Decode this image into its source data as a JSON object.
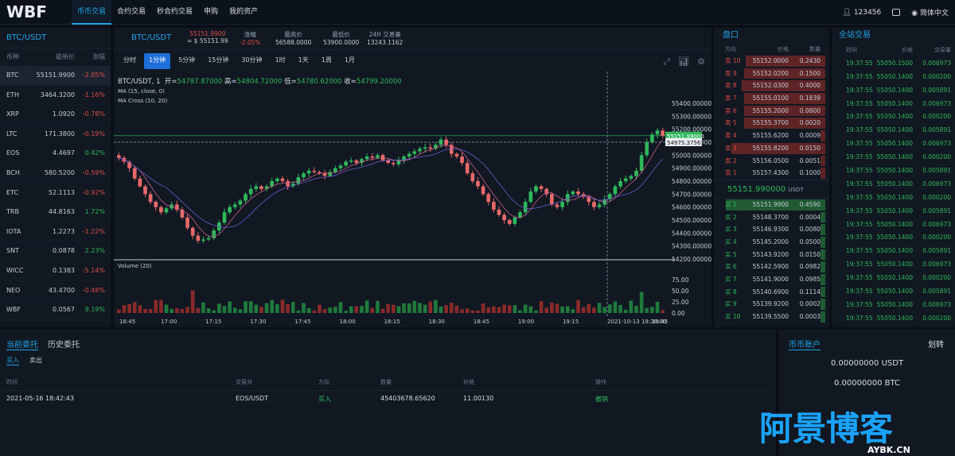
{
  "logo": "WBF",
  "nav": [
    "币币交易",
    "合约交易",
    "秒合约交易",
    "申购",
    "我的资产"
  ],
  "user": {
    "id": "123456",
    "lang": "简体中文"
  },
  "market": {
    "title": "BTC/USDT",
    "cols": [
      "币种",
      "最新价",
      "涨幅"
    ],
    "rows": [
      {
        "sym": "BTC",
        "price": "55151.9900",
        "chg": "-2.05%",
        "dir": "down"
      },
      {
        "sym": "ETH",
        "price": "3464.3200",
        "chg": "-1.16%",
        "dir": "down"
      },
      {
        "sym": "XRP",
        "price": "1.0920",
        "chg": "-0.78%",
        "dir": "down"
      },
      {
        "sym": "LTC",
        "price": "171.3800",
        "chg": "-0.19%",
        "dir": "down"
      },
      {
        "sym": "EOS",
        "price": "4.4697",
        "chg": "0.42%",
        "dir": "up"
      },
      {
        "sym": "BCH",
        "price": "580.5200",
        "chg": "-0.59%",
        "dir": "down"
      },
      {
        "sym": "ETC",
        "price": "52.1113",
        "chg": "-0.92%",
        "dir": "down"
      },
      {
        "sym": "TRB",
        "price": "44.8163",
        "chg": "1.72%",
        "dir": "up"
      },
      {
        "sym": "IOTA",
        "price": "1.2273",
        "chg": "-1.22%",
        "dir": "down"
      },
      {
        "sym": "SNT",
        "price": "0.0878",
        "chg": "2.23%",
        "dir": "up"
      },
      {
        "sym": "WICC",
        "price": "0.1383",
        "chg": "-5.14%",
        "dir": "down"
      },
      {
        "sym": "NEO",
        "price": "43.4700",
        "chg": "-0.48%",
        "dir": "down"
      },
      {
        "sym": "WBF",
        "price": "0.0567",
        "chg": "9.19%",
        "dir": "up"
      }
    ]
  },
  "ticker": {
    "pair": "BTC/USDT",
    "last": "55151.9900",
    "last_cny": "≈ $ 55151.99",
    "chg_label": "涨幅",
    "chg": "-2.05%",
    "high_label": "最高价",
    "high": "56588.0000",
    "low_label": "最低价",
    "low": "53900.0000",
    "vol_label": "24H 交易量",
    "vol": "13243.1162"
  },
  "intervals": [
    "分时",
    "1分钟",
    "5分钟",
    "15分钟",
    "30分钟",
    "1时",
    "1天",
    "1周",
    "1月"
  ],
  "chart_data": {
    "type": "candlestick",
    "title": "BTC/USDT, 1",
    "ohlc": {
      "open_label": "开=",
      "open": "54787.87000",
      "high_label": "高=",
      "high": "54804.72000",
      "low_label": "低=",
      "low": "54780.62000",
      "close_label": "收=",
      "close": "54799.20000"
    },
    "indicators": [
      "MA (15, close, 0)",
      "MA Cross (10, 20)"
    ],
    "volume_label": "Volume (20)",
    "price_axis": [
      "55400.000000",
      "55300.000000",
      "55200.000000",
      "55100.000000",
      "55000.000000",
      "54900.000000",
      "54800.000000",
      "54700.000000",
      "54600.000000",
      "54500.000000",
      "54400.000000",
      "54300.000000",
      "54200.000000"
    ],
    "ylim": [
      54200,
      55400
    ],
    "volume_axis": [
      "75.00",
      "50.00",
      "25.00",
      "0.00"
    ],
    "time_axis": [
      "16:45",
      "17:00",
      "17:15",
      "17:30",
      "17:45",
      "18:00",
      "18:15",
      "18:30",
      "18:45",
      "19:00",
      "19:15",
      "2021-10-13 19:28:00",
      "19:45"
    ],
    "last_price_tag": "55151.99000",
    "crosshair_tag": "54975.37561",
    "closes": [
      54980,
      54950,
      54900,
      54820,
      54760,
      54700,
      54640,
      54600,
      54560,
      54590,
      54620,
      54580,
      54520,
      54440,
      54380,
      54340,
      54350,
      54360,
      54420,
      54480,
      54560,
      54600,
      54620,
      54650,
      54700,
      54740,
      54760,
      54740,
      54760,
      54800,
      54820,
      54800,
      54760,
      54780,
      54830,
      54860,
      54880,
      54870,
      54860,
      54840,
      54870,
      54900,
      54920,
      54950,
      54960,
      54940,
      54970,
      54990,
      54980,
      55000,
      54960,
      54940,
      54930,
      54960,
      54990,
      55010,
      55030,
      55050,
      55060,
      55050,
      55080,
      55120,
      55080,
      55010,
      54990,
      54940,
      54860,
      54800,
      54760,
      54700,
      54640,
      54580,
      54540,
      54500,
      54470,
      54520,
      54560,
      54640,
      54720,
      54760,
      54740,
      54700,
      54620,
      54600,
      54640,
      54700,
      54720,
      54700,
      54680,
      54640,
      54600,
      54620,
      54660,
      54700,
      54760,
      54800,
      54820,
      54840,
      54880,
      55000,
      55100,
      55160,
      55190,
      55150
    ]
  },
  "book": {
    "title": "盘口",
    "cols": [
      "方向",
      "价格",
      "数量"
    ],
    "asks": [
      {
        "side": "卖 10",
        "price": "55152.0000",
        "qty": "0.2430",
        "w": 0.78
      },
      {
        "side": "卖 9",
        "price": "55152.0200",
        "qty": "0.1500",
        "w": 0.8
      },
      {
        "side": "卖 8",
        "price": "55152.0300",
        "qty": "0.4000",
        "w": 0.82
      },
      {
        "side": "卖 7",
        "price": "55155.0100",
        "qty": "0.1839",
        "w": 0.8
      },
      {
        "side": "卖 6",
        "price": "55155.2000",
        "qty": "0.0800",
        "w": 0.8
      },
      {
        "side": "卖 5",
        "price": "55155.3700",
        "qty": "0.0020",
        "w": 0.8
      },
      {
        "side": "卖 4",
        "price": "55155.6200",
        "qty": "0.0009",
        "w": 0.05
      },
      {
        "side": "卖 3",
        "price": "55155.8200",
        "qty": "0.0150",
        "w": 0.92
      },
      {
        "side": "卖 2",
        "price": "55156.0500",
        "qty": "0.0051",
        "w": 0.05
      },
      {
        "side": "卖 1",
        "price": "55157.4300",
        "qty": "0.1000",
        "w": 0.05
      }
    ],
    "last": "55151.990000",
    "last_unit": "USDT",
    "bids": [
      {
        "side": "买 1",
        "price": "55151.9900",
        "qty": "0.4590",
        "w": 0.98
      },
      {
        "side": "买 2",
        "price": "55148.3700",
        "qty": "0.0004",
        "w": 0.05
      },
      {
        "side": "买 3",
        "price": "55146.9300",
        "qty": "0.0080",
        "w": 0.05
      },
      {
        "side": "买 4",
        "price": "55145.2000",
        "qty": "0.0500",
        "w": 0.05
      },
      {
        "side": "买 5",
        "price": "55143.9200",
        "qty": "0.0150",
        "w": 0.05
      },
      {
        "side": "买 6",
        "price": "55142.5900",
        "qty": "0.0982",
        "w": 0.05
      },
      {
        "side": "买 7",
        "price": "55141.9000",
        "qty": "0.0985",
        "w": 0.05
      },
      {
        "side": "买 8",
        "price": "55140.6900",
        "qty": "0.1114",
        "w": 0.05
      },
      {
        "side": "买 9",
        "price": "55139.9200",
        "qty": "0.0002",
        "w": 0.05
      },
      {
        "side": "买 10",
        "price": "55139.5500",
        "qty": "0.0003",
        "w": 0.05
      }
    ]
  },
  "trades": {
    "title": "全站交易",
    "cols": [
      "时间",
      "价格",
      "交易量"
    ],
    "rows": [
      [
        "19:37:55",
        "55050.1500",
        "0.006973"
      ],
      [
        "19:37:55",
        "55050.1400",
        "0.000200"
      ],
      [
        "19:37:55",
        "55050.1400",
        "0.005891"
      ],
      [
        "19:37:55",
        "55050.1400",
        "0.006973"
      ],
      [
        "19:37:55",
        "55050.1400",
        "0.000200"
      ],
      [
        "19:37:55",
        "55050.1400",
        "0.005891"
      ],
      [
        "19:37:55",
        "55050.1400",
        "0.006973"
      ],
      [
        "19:37:55",
        "55050.1400",
        "0.000200"
      ],
      [
        "19:37:55",
        "55050.1400",
        "0.005891"
      ],
      [
        "19:37:55",
        "55050.1400",
        "0.006973"
      ],
      [
        "19:37:55",
        "55050.1400",
        "0.000200"
      ],
      [
        "19:37:55",
        "55050.1400",
        "0.005891"
      ],
      [
        "19:37:55",
        "55050.1400",
        "0.006973"
      ],
      [
        "19:37:55",
        "55050.1400",
        "0.000200"
      ],
      [
        "19:37:55",
        "55050.1400",
        "0.005891"
      ],
      [
        "19:37:55",
        "55050.1400",
        "0.006973"
      ],
      [
        "19:37:55",
        "55050.1400",
        "0.000200"
      ],
      [
        "19:37:55",
        "55050.1400",
        "0.005891"
      ],
      [
        "19:37:55",
        "55050.1400",
        "0.006973"
      ],
      [
        "19:37:55",
        "55050.1400",
        "0.000200"
      ]
    ]
  },
  "orders": {
    "tabs": [
      "当前委托",
      "历史委托"
    ],
    "subtabs": [
      "买入",
      "卖出"
    ],
    "cols": [
      "时间",
      "交易对",
      "方向",
      "数量",
      "价格",
      "操作"
    ],
    "row": {
      "time": "2021-05-16 18:42:43",
      "pair": "EOS/USDT",
      "dir": "买入",
      "qty": "45403678.65620",
      "price": "11.00130",
      "action": "撤销"
    }
  },
  "account": {
    "tab": "币币账户",
    "transfer": "划转",
    "usdt": "0.00000000 USDT",
    "btc": "0.00000000 BTC"
  },
  "watermark": {
    "text1": "阿景博客",
    "text2": "AYBK.CN"
  }
}
